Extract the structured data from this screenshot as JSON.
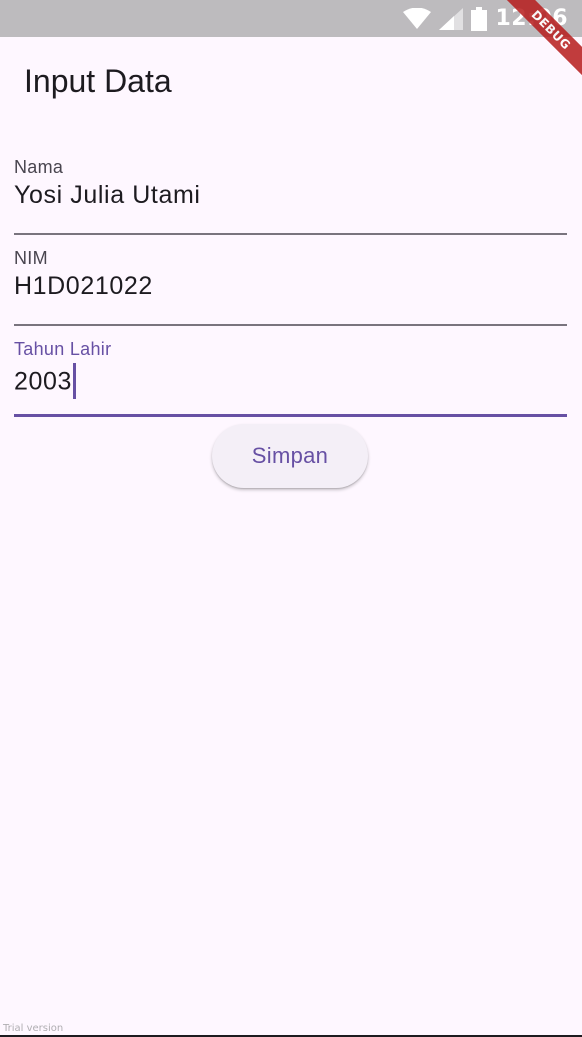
{
  "status_bar": {
    "time": "12:06",
    "debug_label": "DEBUG"
  },
  "app_bar": {
    "title": "Input Data"
  },
  "form": {
    "nama": {
      "label": "Nama",
      "value": "Yosi Julia Utami"
    },
    "nim": {
      "label": "NIM",
      "value": "H1D021022"
    },
    "tahun_lahir": {
      "label": "Tahun Lahir",
      "value": "2003"
    }
  },
  "buttons": {
    "save_label": "Simpan"
  },
  "watermark": {
    "text": "Trial version"
  },
  "colors": {
    "background": "#FEF7FF",
    "primary": "#6750A4",
    "status_bar": "#BDBBBE",
    "debug_banner": "#B71C1C"
  },
  "icons": [
    "wifi-icon",
    "cellular-signal-icon",
    "battery-icon"
  ]
}
